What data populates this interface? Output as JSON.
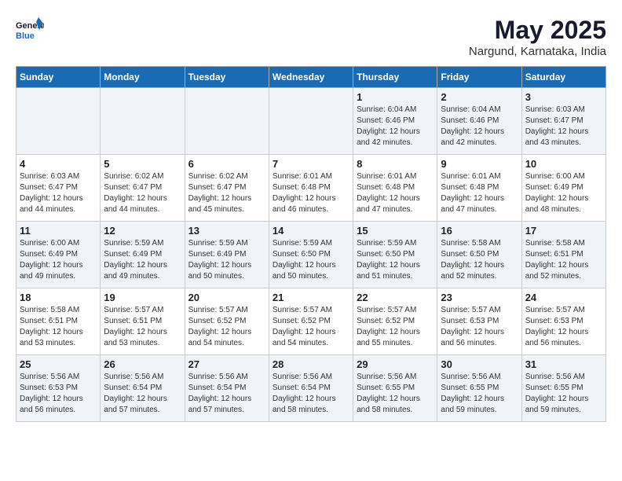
{
  "logo": {
    "line1": "General",
    "line2": "Blue"
  },
  "title": "May 2025",
  "location": "Nargund, Karnataka, India",
  "weekdays": [
    "Sunday",
    "Monday",
    "Tuesday",
    "Wednesday",
    "Thursday",
    "Friday",
    "Saturday"
  ],
  "weeks": [
    [
      {
        "day": "",
        "sunrise": "",
        "sunset": "",
        "daylight": ""
      },
      {
        "day": "",
        "sunrise": "",
        "sunset": "",
        "daylight": ""
      },
      {
        "day": "",
        "sunrise": "",
        "sunset": "",
        "daylight": ""
      },
      {
        "day": "",
        "sunrise": "",
        "sunset": "",
        "daylight": ""
      },
      {
        "day": "1",
        "sunrise": "Sunrise: 6:04 AM",
        "sunset": "Sunset: 6:46 PM",
        "daylight": "Daylight: 12 hours and 42 minutes."
      },
      {
        "day": "2",
        "sunrise": "Sunrise: 6:04 AM",
        "sunset": "Sunset: 6:46 PM",
        "daylight": "Daylight: 12 hours and 42 minutes."
      },
      {
        "day": "3",
        "sunrise": "Sunrise: 6:03 AM",
        "sunset": "Sunset: 6:47 PM",
        "daylight": "Daylight: 12 hours and 43 minutes."
      }
    ],
    [
      {
        "day": "4",
        "sunrise": "Sunrise: 6:03 AM",
        "sunset": "Sunset: 6:47 PM",
        "daylight": "Daylight: 12 hours and 44 minutes."
      },
      {
        "day": "5",
        "sunrise": "Sunrise: 6:02 AM",
        "sunset": "Sunset: 6:47 PM",
        "daylight": "Daylight: 12 hours and 44 minutes."
      },
      {
        "day": "6",
        "sunrise": "Sunrise: 6:02 AM",
        "sunset": "Sunset: 6:47 PM",
        "daylight": "Daylight: 12 hours and 45 minutes."
      },
      {
        "day": "7",
        "sunrise": "Sunrise: 6:01 AM",
        "sunset": "Sunset: 6:48 PM",
        "daylight": "Daylight: 12 hours and 46 minutes."
      },
      {
        "day": "8",
        "sunrise": "Sunrise: 6:01 AM",
        "sunset": "Sunset: 6:48 PM",
        "daylight": "Daylight: 12 hours and 47 minutes."
      },
      {
        "day": "9",
        "sunrise": "Sunrise: 6:01 AM",
        "sunset": "Sunset: 6:48 PM",
        "daylight": "Daylight: 12 hours and 47 minutes."
      },
      {
        "day": "10",
        "sunrise": "Sunrise: 6:00 AM",
        "sunset": "Sunset: 6:49 PM",
        "daylight": "Daylight: 12 hours and 48 minutes."
      }
    ],
    [
      {
        "day": "11",
        "sunrise": "Sunrise: 6:00 AM",
        "sunset": "Sunset: 6:49 PM",
        "daylight": "Daylight: 12 hours and 49 minutes."
      },
      {
        "day": "12",
        "sunrise": "Sunrise: 5:59 AM",
        "sunset": "Sunset: 6:49 PM",
        "daylight": "Daylight: 12 hours and 49 minutes."
      },
      {
        "day": "13",
        "sunrise": "Sunrise: 5:59 AM",
        "sunset": "Sunset: 6:49 PM",
        "daylight": "Daylight: 12 hours and 50 minutes."
      },
      {
        "day": "14",
        "sunrise": "Sunrise: 5:59 AM",
        "sunset": "Sunset: 6:50 PM",
        "daylight": "Daylight: 12 hours and 50 minutes."
      },
      {
        "day": "15",
        "sunrise": "Sunrise: 5:59 AM",
        "sunset": "Sunset: 6:50 PM",
        "daylight": "Daylight: 12 hours and 51 minutes."
      },
      {
        "day": "16",
        "sunrise": "Sunrise: 5:58 AM",
        "sunset": "Sunset: 6:50 PM",
        "daylight": "Daylight: 12 hours and 52 minutes."
      },
      {
        "day": "17",
        "sunrise": "Sunrise: 5:58 AM",
        "sunset": "Sunset: 6:51 PM",
        "daylight": "Daylight: 12 hours and 52 minutes."
      }
    ],
    [
      {
        "day": "18",
        "sunrise": "Sunrise: 5:58 AM",
        "sunset": "Sunset: 6:51 PM",
        "daylight": "Daylight: 12 hours and 53 minutes."
      },
      {
        "day": "19",
        "sunrise": "Sunrise: 5:57 AM",
        "sunset": "Sunset: 6:51 PM",
        "daylight": "Daylight: 12 hours and 53 minutes."
      },
      {
        "day": "20",
        "sunrise": "Sunrise: 5:57 AM",
        "sunset": "Sunset: 6:52 PM",
        "daylight": "Daylight: 12 hours and 54 minutes."
      },
      {
        "day": "21",
        "sunrise": "Sunrise: 5:57 AM",
        "sunset": "Sunset: 6:52 PM",
        "daylight": "Daylight: 12 hours and 54 minutes."
      },
      {
        "day": "22",
        "sunrise": "Sunrise: 5:57 AM",
        "sunset": "Sunset: 6:52 PM",
        "daylight": "Daylight: 12 hours and 55 minutes."
      },
      {
        "day": "23",
        "sunrise": "Sunrise: 5:57 AM",
        "sunset": "Sunset: 6:53 PM",
        "daylight": "Daylight: 12 hours and 56 minutes."
      },
      {
        "day": "24",
        "sunrise": "Sunrise: 5:57 AM",
        "sunset": "Sunset: 6:53 PM",
        "daylight": "Daylight: 12 hours and 56 minutes."
      }
    ],
    [
      {
        "day": "25",
        "sunrise": "Sunrise: 5:56 AM",
        "sunset": "Sunset: 6:53 PM",
        "daylight": "Daylight: 12 hours and 56 minutes."
      },
      {
        "day": "26",
        "sunrise": "Sunrise: 5:56 AM",
        "sunset": "Sunset: 6:54 PM",
        "daylight": "Daylight: 12 hours and 57 minutes."
      },
      {
        "day": "27",
        "sunrise": "Sunrise: 5:56 AM",
        "sunset": "Sunset: 6:54 PM",
        "daylight": "Daylight: 12 hours and 57 minutes."
      },
      {
        "day": "28",
        "sunrise": "Sunrise: 5:56 AM",
        "sunset": "Sunset: 6:54 PM",
        "daylight": "Daylight: 12 hours and 58 minutes."
      },
      {
        "day": "29",
        "sunrise": "Sunrise: 5:56 AM",
        "sunset": "Sunset: 6:55 PM",
        "daylight": "Daylight: 12 hours and 58 minutes."
      },
      {
        "day": "30",
        "sunrise": "Sunrise: 5:56 AM",
        "sunset": "Sunset: 6:55 PM",
        "daylight": "Daylight: 12 hours and 59 minutes."
      },
      {
        "day": "31",
        "sunrise": "Sunrise: 5:56 AM",
        "sunset": "Sunset: 6:55 PM",
        "daylight": "Daylight: 12 hours and 59 minutes."
      }
    ]
  ]
}
